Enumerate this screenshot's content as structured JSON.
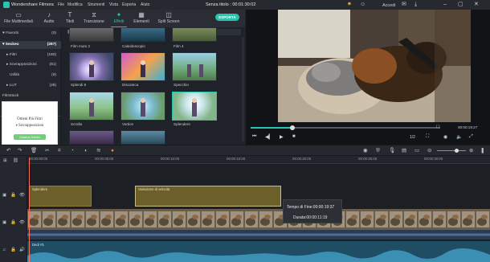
{
  "titlebar": {
    "app_name": "Wondershare Filmora",
    "menus": [
      "File",
      "Modifica",
      "Strumenti",
      "Vista",
      "Esporta",
      "Aiuto"
    ],
    "project": "Senza titolo : 00:01:30:02",
    "login": "Accedi"
  },
  "tabs": [
    {
      "label": "File Multimediali",
      "icon": "folder-icon"
    },
    {
      "label": "Audio",
      "icon": "music-icon"
    },
    {
      "label": "Titoli",
      "icon": "text-icon"
    },
    {
      "label": "Transizione",
      "icon": "transition-icon"
    },
    {
      "label": "Effetti",
      "icon": "effects-icon"
    },
    {
      "label": "Elementi",
      "icon": "elements-icon"
    },
    {
      "label": "Split Screen",
      "icon": "split-screen-icon"
    }
  ],
  "export_label": "ESPORTA",
  "sidebar": {
    "items": [
      {
        "label": "Favoriti",
        "count": "(0)"
      },
      {
        "label": "Seckeo",
        "count": "(287)"
      },
      {
        "label": "Filtri",
        "count": "(180)"
      },
      {
        "label": "Sovrapposizioni",
        "count": "(81)"
      },
      {
        "label": "Utilità",
        "count": "(9)"
      },
      {
        "label": "LUT",
        "count": "(28)"
      }
    ],
    "filmstock_label": "Filmstock",
    "promo": {
      "line1": "Ottieni Più Filtri",
      "line2": "e Sovrapposizioni",
      "button": "Scarica Subito"
    }
  },
  "effects": {
    "search_placeholder": "Ricerca",
    "top_labels": [
      "Film muto 2",
      "Caleidoscopio",
      "Film 4"
    ],
    "grid": [
      {
        "label": "Splendi 8"
      },
      {
        "label": "Discoteca"
      },
      {
        "label": "Specchio"
      },
      {
        "label": "Scrolla"
      },
      {
        "label": "Vortice"
      },
      {
        "label": "Splendere"
      }
    ]
  },
  "preview": {
    "timecode": "00:00:19:27",
    "progress": 0.22,
    "ratio": "1/2"
  },
  "timeline": {
    "ruler": [
      "00:00:00:00",
      "00:00:05:00",
      "00:00:10:00",
      "00:00:15:00",
      "00:00:20:00",
      "00:00:25:00",
      "00:00:30:00"
    ],
    "fx_clip_1": "Splendere",
    "fx_clip_2": "Variazione di velocità",
    "tooltip": {
      "start": "Tempo di Fine:00:00:19:37",
      "duration": "Durata:00:00:11:19"
    },
    "audio_label": "Dedr #1"
  }
}
